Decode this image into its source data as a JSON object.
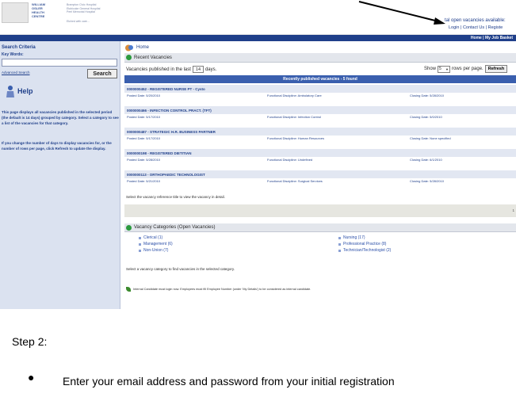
{
  "header": {
    "logo_lines": [
      "WILLIAM",
      "OSLER",
      "HEALTH",
      "CENTRE"
    ],
    "tagline_lines": [
      "Brampton Civic Hospital",
      "Etobicoke General Hospital",
      "Peel Memorial Hospital"
    ],
    "tagline2": "Etched with care…",
    "open_vacancies": "tal open vacancies available:",
    "top_links": "Login | Contact Us | Registe",
    "nav": "Home | My Job Basket"
  },
  "sidebar": {
    "title": "Search Criteria",
    "keywords_label": "Key Words:",
    "advanced_link": "Advanced Search",
    "search_button": "Search",
    "help_title": "Help",
    "help_para1": "This page displays all vacancies published in the selected period (the default is 14 days) grouped by category. Select a category to see a list of the vacancies for that category.",
    "help_para2": "If you change the number of days to display vacancies for, or the number of rows per page, click Refresh to update the display."
  },
  "main": {
    "home_label": "Home",
    "recent_header": "Recent Vacancies",
    "published_prefix": "Vacancies published in the last",
    "published_days": "14",
    "published_suffix": "days.",
    "show_label": "Show",
    "rows_value": "5",
    "rows_suffix": "rows per page.",
    "refresh_button": "Refresh",
    "band": "Recently published vacancies - 5 found",
    "vacancies": [
      {
        "title": "0000000452 - REGISTERED NURSE PT - Cysto",
        "posted": "Posted Date: 5/20/2010",
        "discipline": "Functional Discipline: Ambulatory Care",
        "closing": "Closing Date: 5/28/2010"
      },
      {
        "title": "0000000466 - INFECTION CONTROL PRACT. (TFT)",
        "posted": "Posted Date: 5/17/2010",
        "discipline": "Functional Discipline: Infection Control",
        "closing": "Closing Date: 5/0/2010"
      },
      {
        "title": "0000000487 - STRATEGIC H.R. BUSINESS PARTNER",
        "posted": "Posted Date: 5/17/2010",
        "discipline": "Functional Discipline: Human Resources",
        "closing": "Closing Date: None specified"
      },
      {
        "title": "0000000198 - REGISTERED DIETITIAN",
        "posted": "Posted Date: 5/28/2010",
        "discipline": "Functional Discipline: Undefined",
        "closing": "Closing Date: 6/1/2010"
      },
      {
        "title": "0000000113 - ORTHOPAEDIC TECHNOLOGIST",
        "posted": "Posted Date: 5/21/2010",
        "discipline": "Functional Discipline: Surgical Services",
        "closing": "Closing Date: 5/28/2010"
      }
    ],
    "select_note": "Select the vacancy reference title to view the vacancy in detail.",
    "page_number": "1",
    "categories_header": "Vacancy Categories (Open Vacancies)",
    "categories_left": [
      "Clerical (1)",
      "Management (6)",
      "Non-Union (7)"
    ],
    "categories_right": [
      "Nursing (17)",
      "Professional Practice (8)",
      "Technician/Technologist (2)"
    ],
    "category_note": "Select a vacancy category to find vacancies in the selected category.",
    "internal_note": "Internal Candidate must login now. Employees must fill Employee Number (under 'My Details') to be considered as internal candidate."
  },
  "document": {
    "step_heading": "Step 2:",
    "bullet_text": "Enter your email address and password from your initial registration"
  },
  "colors": {
    "nav_blue": "#1f3f8a",
    "step_heading": "#000000"
  }
}
